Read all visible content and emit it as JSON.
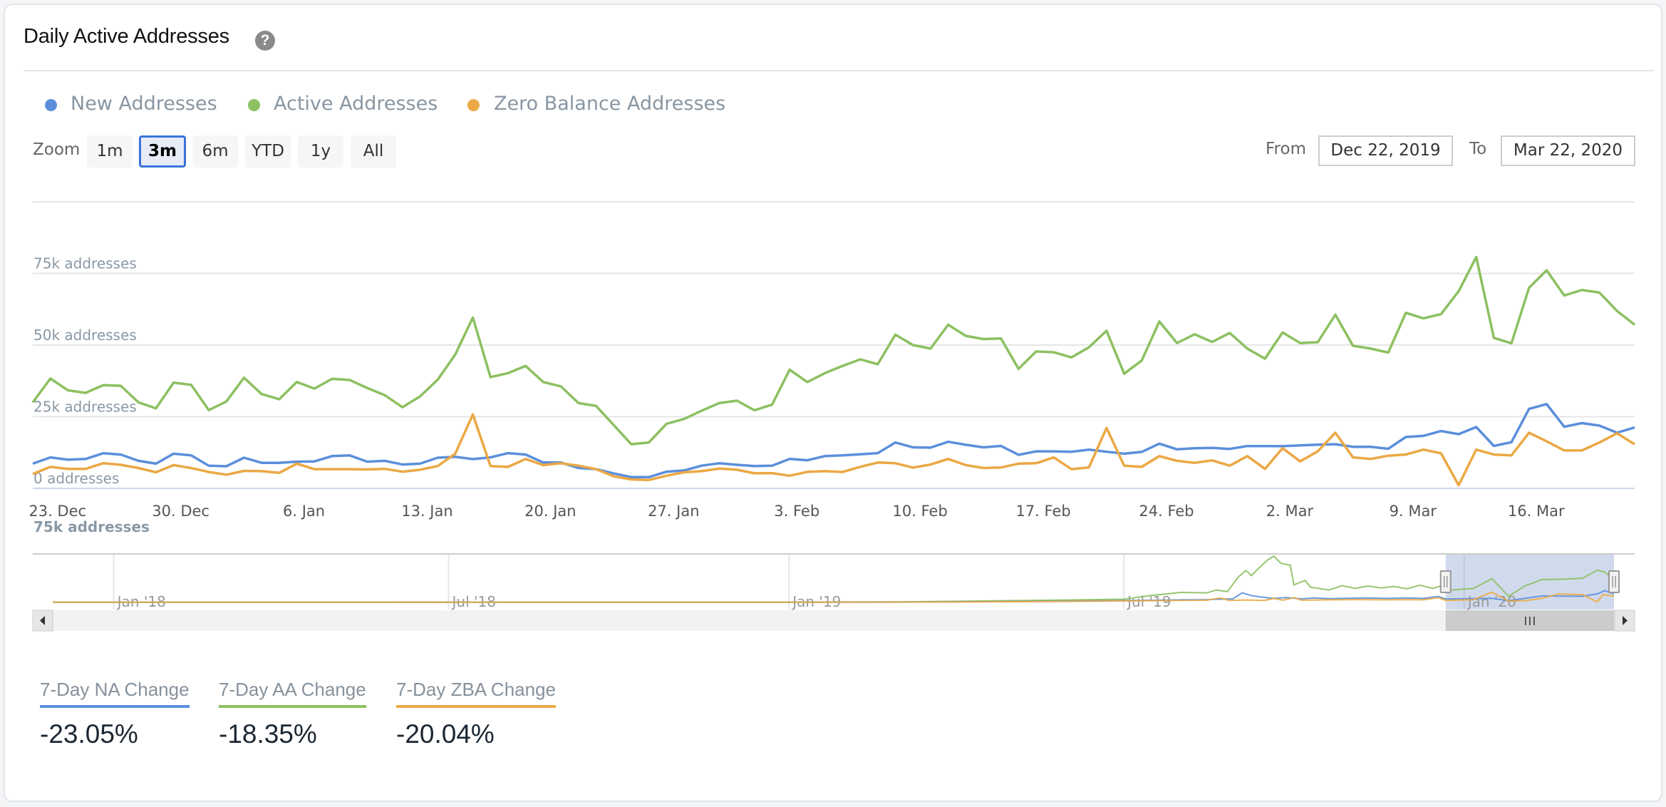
{
  "card": {
    "title": "Daily Active Addresses",
    "help_icon": "?"
  },
  "legend": [
    {
      "label": "New Addresses",
      "color": "#5b8fdb"
    },
    {
      "label": "Active Addresses",
      "color": "#8cc061"
    },
    {
      "label": "Zero Balance Addresses",
      "color": "#eba844"
    }
  ],
  "range_selector": {
    "zoom_label": "Zoom",
    "buttons": [
      "1m",
      "3m",
      "6m",
      "YTD",
      "1y",
      "All"
    ],
    "selected": "3m",
    "from_label": "From",
    "from_value": "Dec 22, 2019",
    "to_label": "To",
    "to_value": "Mar 22, 2020"
  },
  "stats": [
    {
      "title": "7-Day NA Change",
      "value": "-23.05%",
      "color": "#5b8fdb"
    },
    {
      "title": "7-Day AA Change",
      "value": "-18.35%",
      "color": "#8cc061"
    },
    {
      "title": "7-Day ZBA Change",
      "value": "-20.04%",
      "color": "#eba844"
    }
  ],
  "chart_data": {
    "type": "line",
    "title": "Daily Active Addresses",
    "x_start": "2019-12-22",
    "x_end": "2020-03-22",
    "x_interval": "1 day",
    "xlabel": "",
    "ylabel": "",
    "ylim": [
      0,
      100000
    ],
    "y_ticks": [
      0,
      25000,
      50000,
      75000,
      100000
    ],
    "y_tick_labels": [
      "0 addresses",
      "25k addresses",
      "50k addresses",
      "75k addresses",
      ""
    ],
    "x_tick_labels": [
      {
        "date": "2019-12-23",
        "label": "23. Dec"
      },
      {
        "date": "2019-12-30",
        "label": "30. Dec"
      },
      {
        "date": "2020-01-06",
        "label": "6. Jan"
      },
      {
        "date": "2020-01-13",
        "label": "13. Jan"
      },
      {
        "date": "2020-01-20",
        "label": "20. Jan"
      },
      {
        "date": "2020-01-27",
        "label": "27. Jan"
      },
      {
        "date": "2020-02-03",
        "label": "3. Feb"
      },
      {
        "date": "2020-02-10",
        "label": "10. Feb"
      },
      {
        "date": "2020-02-17",
        "label": "17. Feb"
      },
      {
        "date": "2020-02-24",
        "label": "24. Feb"
      },
      {
        "date": "2020-03-02",
        "label": "2. Mar"
      },
      {
        "date": "2020-03-09",
        "label": "9. Mar"
      },
      {
        "date": "2020-03-16",
        "label": "16. Mar"
      }
    ],
    "grid": true,
    "legend_position": "top-left",
    "series": [
      {
        "name": "New Addresses",
        "color": "#5b8fdb",
        "values": [
          8600,
          10800,
          10000,
          10250,
          12250,
          11800,
          9600,
          8600,
          12100,
          11500,
          7900,
          7700,
          10700,
          8900,
          8900,
          9300,
          9400,
          11250,
          11500,
          9300,
          9600,
          8300,
          8600,
          10700,
          11000,
          10200,
          10800,
          12300,
          11800,
          9000,
          9000,
          7100,
          6700,
          5200,
          3900,
          3900,
          5800,
          6250,
          7900,
          8750,
          8200,
          7750,
          7900,
          10250,
          9800,
          11250,
          11500,
          11900,
          12300,
          16000,
          14300,
          14200,
          16250,
          15200,
          14300,
          14800,
          11700,
          12900,
          12900,
          12750,
          13500,
          12750,
          12100,
          12700,
          15600,
          13600,
          14000,
          14100,
          13750,
          14750,
          14750,
          14700,
          15000,
          15250,
          15400,
          14500,
          14500,
          13800,
          17900,
          18300,
          20000,
          18900,
          21400,
          14800,
          16100,
          27700,
          29400,
          21500,
          22750,
          21900,
          19400,
          21250
        ]
      },
      {
        "name": "Active Addresses",
        "color": "#8cc061",
        "values": [
          30000,
          38300,
          34200,
          33300,
          36000,
          35800,
          30000,
          27900,
          36900,
          36100,
          27300,
          30300,
          38600,
          32900,
          31100,
          37100,
          34800,
          38200,
          37800,
          35000,
          32500,
          28300,
          32100,
          37900,
          46700,
          59600,
          38800,
          40200,
          42700,
          37100,
          35600,
          29750,
          28750,
          22100,
          15400,
          16000,
          22500,
          24200,
          27100,
          29750,
          30600,
          27250,
          29200,
          41400,
          37100,
          40200,
          42700,
          45000,
          43300,
          53600,
          50000,
          48750,
          57100,
          53200,
          52100,
          52300,
          41700,
          47750,
          47500,
          45700,
          49200,
          55000,
          40000,
          44600,
          58200,
          50700,
          53750,
          51100,
          54200,
          48750,
          45250,
          54400,
          50700,
          51000,
          60600,
          49750,
          48750,
          47400,
          61250,
          59300,
          60800,
          68750,
          80700,
          52500,
          50600,
          70000,
          76100,
          67300,
          69200,
          68300,
          61900,
          57100
        ]
      },
      {
        "name": "Zero Balance Addresses",
        "color": "#eba844",
        "values": [
          5000,
          7500,
          6800,
          6800,
          8750,
          8200,
          7100,
          5600,
          8100,
          7100,
          5700,
          4750,
          6100,
          6000,
          5400,
          8600,
          6700,
          6700,
          6700,
          6600,
          6800,
          5800,
          6500,
          7750,
          12100,
          25800,
          7750,
          7500,
          10250,
          8100,
          8750,
          7900,
          6700,
          4200,
          3100,
          2900,
          4400,
          5600,
          6000,
          6900,
          6500,
          5250,
          5300,
          4400,
          5750,
          6000,
          5700,
          7500,
          9000,
          8750,
          7250,
          8300,
          10250,
          8100,
          7100,
          7300,
          8600,
          8750,
          10800,
          6700,
          7300,
          21100,
          7900,
          7500,
          11250,
          9600,
          8900,
          9750,
          7900,
          11250,
          6800,
          14000,
          9400,
          12900,
          19400,
          10800,
          10250,
          11400,
          11800,
          13500,
          12250,
          1100,
          13500,
          11800,
          11500,
          19400,
          16400,
          13200,
          13200,
          16000,
          19200,
          15400
        ]
      }
    ],
    "navigator": {
      "x_tick_labels": [
        {
          "date": "2018-01-01",
          "label": "Jan '18"
        },
        {
          "date": "2018-07-01",
          "label": "Jul '18"
        },
        {
          "date": "2019-01-01",
          "label": "Jan '19"
        },
        {
          "date": "2019-07-01",
          "label": "Jul '19"
        },
        {
          "date": "2020-01-01",
          "label": "Jan '20"
        }
      ],
      "y_label": "75k addresses",
      "x_start": "2017-11-29",
      "x_end": "2020-03-22",
      "selected_range": [
        "2019-12-22",
        "2020-03-22"
      ],
      "series": [
        {
          "name": "New Addresses",
          "points": [
            [
              "2017-11-29",
              300
            ],
            [
              "2018-06-01",
              300
            ],
            [
              "2019-01-01",
              400
            ],
            [
              "2019-03-01",
              800
            ],
            [
              "2019-04-15",
              1800
            ],
            [
              "2019-06-01",
              3000
            ],
            [
              "2019-07-01",
              4500
            ],
            [
              "2019-07-20",
              5500
            ],
            [
              "2019-08-01",
              6500
            ],
            [
              "2019-08-15",
              7000
            ],
            [
              "2019-08-22",
              8000
            ],
            [
              "2019-08-29",
              9000
            ],
            [
              "2019-09-03",
              24000
            ],
            [
              "2019-09-08",
              17000
            ],
            [
              "2019-09-14",
              13000
            ],
            [
              "2019-09-20",
              10000
            ],
            [
              "2019-09-27",
              12000
            ],
            [
              "2019-10-05",
              9000
            ],
            [
              "2019-10-12",
              11000
            ],
            [
              "2019-10-20",
              9500
            ],
            [
              "2019-11-01",
              10500
            ],
            [
              "2019-11-10",
              11000
            ],
            [
              "2019-11-20",
              10000
            ],
            [
              "2019-12-01",
              11000
            ],
            [
              "2019-12-10",
              10000
            ],
            [
              "2019-12-18",
              15000
            ],
            [
              "2019-12-22",
              8600
            ],
            [
              "2020-01-06",
              9400
            ],
            [
              "2020-01-16",
              10200
            ],
            [
              "2020-01-25",
              3900
            ],
            [
              "2020-02-03",
              10250
            ],
            [
              "2020-02-12",
              16250
            ],
            [
              "2020-02-24",
              15600
            ],
            [
              "2020-03-05",
              15400
            ],
            [
              "2020-03-13",
              21400
            ],
            [
              "2020-03-17",
              29400
            ],
            [
              "2020-03-22",
              21250
            ]
          ]
        },
        {
          "name": "Active Addresses",
          "points": [
            [
              "2017-11-29",
              500
            ],
            [
              "2018-06-01",
              500
            ],
            [
              "2019-01-01",
              700
            ],
            [
              "2019-03-01",
              1500
            ],
            [
              "2019-04-15",
              3500
            ],
            [
              "2019-06-01",
              6000
            ],
            [
              "2019-07-01",
              8000
            ],
            [
              "2019-07-15",
              17000
            ],
            [
              "2019-08-01",
              25000
            ],
            [
              "2019-08-15",
              24000
            ],
            [
              "2019-08-20",
              31000
            ],
            [
              "2019-08-26",
              27000
            ],
            [
              "2019-09-01",
              64000
            ],
            [
              "2019-09-05",
              80000
            ],
            [
              "2019-09-08",
              67000
            ],
            [
              "2019-09-12",
              86000
            ],
            [
              "2019-09-17",
              107000
            ],
            [
              "2019-09-20",
              116000
            ],
            [
              "2019-09-24",
              98000
            ],
            [
              "2019-09-29",
              93000
            ],
            [
              "2019-10-01",
              44000
            ],
            [
              "2019-10-07",
              55000
            ],
            [
              "2019-10-10",
              38000
            ],
            [
              "2019-10-20",
              31000
            ],
            [
              "2019-10-27",
              42000
            ],
            [
              "2019-11-03",
              35000
            ],
            [
              "2019-11-10",
              41000
            ],
            [
              "2019-11-17",
              36000
            ],
            [
              "2019-11-24",
              40000
            ],
            [
              "2019-12-01",
              34000
            ],
            [
              "2019-12-08",
              43000
            ],
            [
              "2019-12-15",
              35000
            ],
            [
              "2019-12-20",
              42000
            ],
            [
              "2019-12-22",
              30000
            ],
            [
              "2020-01-06",
              34800
            ],
            [
              "2020-01-16",
              59600
            ],
            [
              "2020-01-25",
              15400
            ],
            [
              "2020-02-03",
              41400
            ],
            [
              "2020-02-12",
              57100
            ],
            [
              "2020-02-24",
              58200
            ],
            [
              "2020-03-05",
              60600
            ],
            [
              "2020-03-13",
              80700
            ],
            [
              "2020-03-17",
              76100
            ],
            [
              "2020-03-22",
              57100
            ]
          ]
        },
        {
          "name": "Zero Balance Addresses",
          "points": [
            [
              "2017-11-29",
              300
            ],
            [
              "2018-06-01",
              300
            ],
            [
              "2019-01-01",
              400
            ],
            [
              "2019-03-01",
              700
            ],
            [
              "2019-04-15",
              1500
            ],
            [
              "2019-06-01",
              2500
            ],
            [
              "2019-07-01",
              3500
            ],
            [
              "2019-07-20",
              4500
            ],
            [
              "2019-08-01",
              5000
            ],
            [
              "2019-08-15",
              5500
            ],
            [
              "2019-08-22",
              11000
            ],
            [
              "2019-08-27",
              5000
            ],
            [
              "2019-09-05",
              6000
            ],
            [
              "2019-09-15",
              5000
            ],
            [
              "2019-09-20",
              10000
            ],
            [
              "2019-09-25",
              5500
            ],
            [
              "2019-10-01",
              12000
            ],
            [
              "2019-10-05",
              5500
            ],
            [
              "2019-10-20",
              6500
            ],
            [
              "2019-11-05",
              7000
            ],
            [
              "2019-11-20",
              6500
            ],
            [
              "2019-12-01",
              7000
            ],
            [
              "2019-12-10",
              6500
            ],
            [
              "2019-12-18",
              12000
            ],
            [
              "2019-12-22",
              5000
            ],
            [
              "2020-01-06",
              6700
            ],
            [
              "2020-01-16",
              25800
            ],
            [
              "2020-01-25",
              3100
            ],
            [
              "2020-02-03",
              4400
            ],
            [
              "2020-02-12",
              10250
            ],
            [
              "2020-02-21",
              21100
            ],
            [
              "2020-03-05",
              19400
            ],
            [
              "2020-03-13",
              1100
            ],
            [
              "2020-03-16",
              19400
            ],
            [
              "2020-03-22",
              15400
            ]
          ]
        }
      ]
    }
  }
}
